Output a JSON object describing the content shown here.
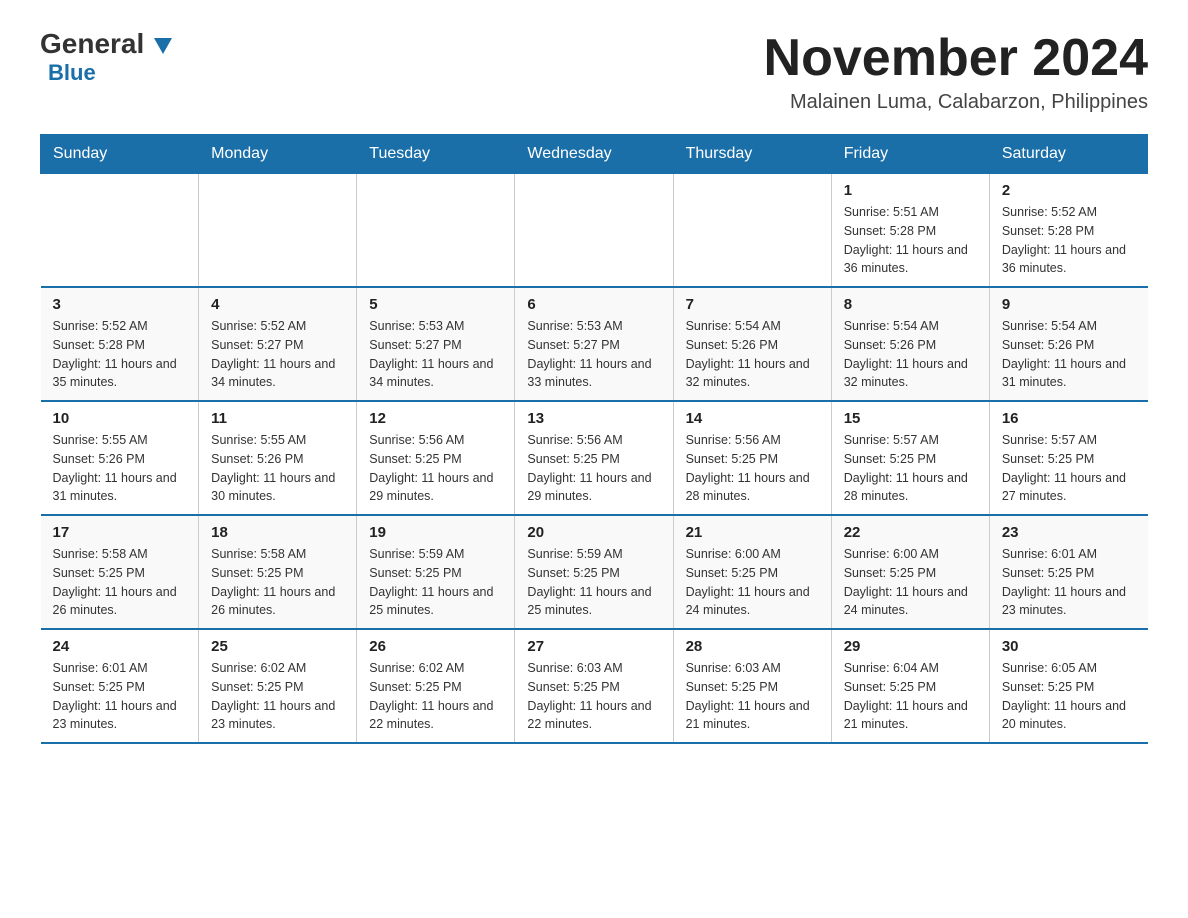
{
  "header": {
    "logo_general": "General",
    "logo_blue": "Blue",
    "month_year": "November 2024",
    "location": "Malainen Luma, Calabarzon, Philippines"
  },
  "weekdays": [
    "Sunday",
    "Monday",
    "Tuesday",
    "Wednesday",
    "Thursday",
    "Friday",
    "Saturday"
  ],
  "weeks": [
    [
      {
        "day": "",
        "info": ""
      },
      {
        "day": "",
        "info": ""
      },
      {
        "day": "",
        "info": ""
      },
      {
        "day": "",
        "info": ""
      },
      {
        "day": "",
        "info": ""
      },
      {
        "day": "1",
        "info": "Sunrise: 5:51 AM\nSunset: 5:28 PM\nDaylight: 11 hours and 36 minutes."
      },
      {
        "day": "2",
        "info": "Sunrise: 5:52 AM\nSunset: 5:28 PM\nDaylight: 11 hours and 36 minutes."
      }
    ],
    [
      {
        "day": "3",
        "info": "Sunrise: 5:52 AM\nSunset: 5:28 PM\nDaylight: 11 hours and 35 minutes."
      },
      {
        "day": "4",
        "info": "Sunrise: 5:52 AM\nSunset: 5:27 PM\nDaylight: 11 hours and 34 minutes."
      },
      {
        "day": "5",
        "info": "Sunrise: 5:53 AM\nSunset: 5:27 PM\nDaylight: 11 hours and 34 minutes."
      },
      {
        "day": "6",
        "info": "Sunrise: 5:53 AM\nSunset: 5:27 PM\nDaylight: 11 hours and 33 minutes."
      },
      {
        "day": "7",
        "info": "Sunrise: 5:54 AM\nSunset: 5:26 PM\nDaylight: 11 hours and 32 minutes."
      },
      {
        "day": "8",
        "info": "Sunrise: 5:54 AM\nSunset: 5:26 PM\nDaylight: 11 hours and 32 minutes."
      },
      {
        "day": "9",
        "info": "Sunrise: 5:54 AM\nSunset: 5:26 PM\nDaylight: 11 hours and 31 minutes."
      }
    ],
    [
      {
        "day": "10",
        "info": "Sunrise: 5:55 AM\nSunset: 5:26 PM\nDaylight: 11 hours and 31 minutes."
      },
      {
        "day": "11",
        "info": "Sunrise: 5:55 AM\nSunset: 5:26 PM\nDaylight: 11 hours and 30 minutes."
      },
      {
        "day": "12",
        "info": "Sunrise: 5:56 AM\nSunset: 5:25 PM\nDaylight: 11 hours and 29 minutes."
      },
      {
        "day": "13",
        "info": "Sunrise: 5:56 AM\nSunset: 5:25 PM\nDaylight: 11 hours and 29 minutes."
      },
      {
        "day": "14",
        "info": "Sunrise: 5:56 AM\nSunset: 5:25 PM\nDaylight: 11 hours and 28 minutes."
      },
      {
        "day": "15",
        "info": "Sunrise: 5:57 AM\nSunset: 5:25 PM\nDaylight: 11 hours and 28 minutes."
      },
      {
        "day": "16",
        "info": "Sunrise: 5:57 AM\nSunset: 5:25 PM\nDaylight: 11 hours and 27 minutes."
      }
    ],
    [
      {
        "day": "17",
        "info": "Sunrise: 5:58 AM\nSunset: 5:25 PM\nDaylight: 11 hours and 26 minutes."
      },
      {
        "day": "18",
        "info": "Sunrise: 5:58 AM\nSunset: 5:25 PM\nDaylight: 11 hours and 26 minutes."
      },
      {
        "day": "19",
        "info": "Sunrise: 5:59 AM\nSunset: 5:25 PM\nDaylight: 11 hours and 25 minutes."
      },
      {
        "day": "20",
        "info": "Sunrise: 5:59 AM\nSunset: 5:25 PM\nDaylight: 11 hours and 25 minutes."
      },
      {
        "day": "21",
        "info": "Sunrise: 6:00 AM\nSunset: 5:25 PM\nDaylight: 11 hours and 24 minutes."
      },
      {
        "day": "22",
        "info": "Sunrise: 6:00 AM\nSunset: 5:25 PM\nDaylight: 11 hours and 24 minutes."
      },
      {
        "day": "23",
        "info": "Sunrise: 6:01 AM\nSunset: 5:25 PM\nDaylight: 11 hours and 23 minutes."
      }
    ],
    [
      {
        "day": "24",
        "info": "Sunrise: 6:01 AM\nSunset: 5:25 PM\nDaylight: 11 hours and 23 minutes."
      },
      {
        "day": "25",
        "info": "Sunrise: 6:02 AM\nSunset: 5:25 PM\nDaylight: 11 hours and 23 minutes."
      },
      {
        "day": "26",
        "info": "Sunrise: 6:02 AM\nSunset: 5:25 PM\nDaylight: 11 hours and 22 minutes."
      },
      {
        "day": "27",
        "info": "Sunrise: 6:03 AM\nSunset: 5:25 PM\nDaylight: 11 hours and 22 minutes."
      },
      {
        "day": "28",
        "info": "Sunrise: 6:03 AM\nSunset: 5:25 PM\nDaylight: 11 hours and 21 minutes."
      },
      {
        "day": "29",
        "info": "Sunrise: 6:04 AM\nSunset: 5:25 PM\nDaylight: 11 hours and 21 minutes."
      },
      {
        "day": "30",
        "info": "Sunrise: 6:05 AM\nSunset: 5:25 PM\nDaylight: 11 hours and 20 minutes."
      }
    ]
  ]
}
